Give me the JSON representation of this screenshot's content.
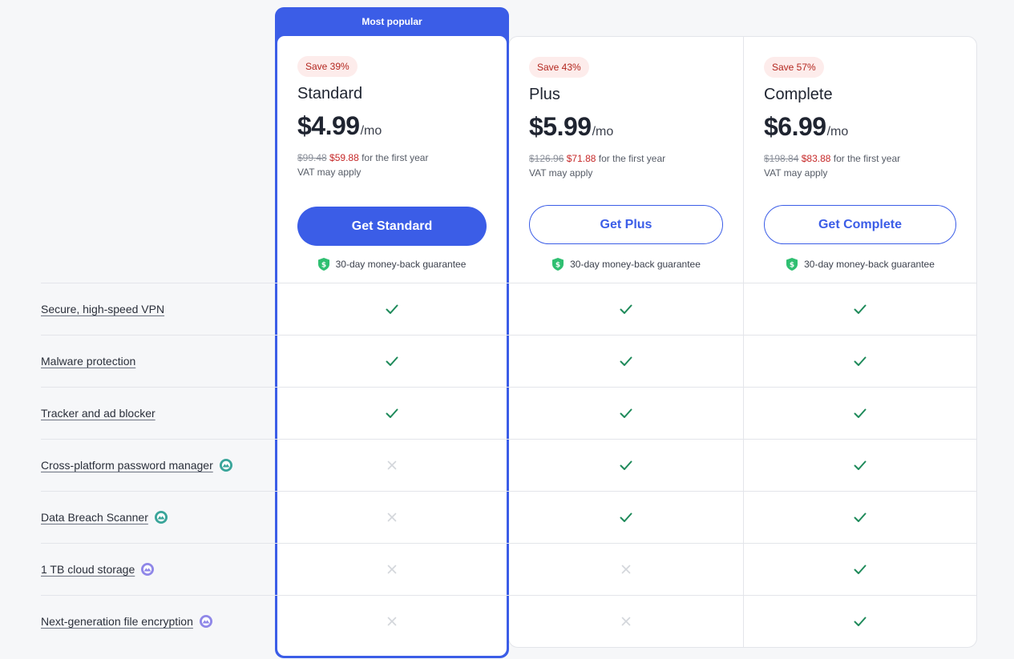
{
  "banner": {
    "label": "Most popular"
  },
  "plans": [
    {
      "save": "Save 39%",
      "name": "Standard",
      "price": "$4.99",
      "per": "/mo",
      "old_price": "$99.48",
      "new_price": "$59.88",
      "first_year": "for the first year",
      "vat": "VAT may apply",
      "cta": "Get Standard",
      "guarantee": "30-day money-back guarantee"
    },
    {
      "save": "Save 43%",
      "name": "Plus",
      "price": "$5.99",
      "per": "/mo",
      "old_price": "$126.96",
      "new_price": "$71.88",
      "first_year": "for the first year",
      "vat": "VAT may apply",
      "cta": "Get Plus",
      "guarantee": "30-day money-back guarantee"
    },
    {
      "save": "Save 57%",
      "name": "Complete",
      "price": "$6.99",
      "per": "/mo",
      "old_price": "$198.84",
      "new_price": "$83.88",
      "first_year": "for the first year",
      "vat": "VAT may apply",
      "cta": "Get Complete",
      "guarantee": "30-day money-back guarantee"
    }
  ],
  "features": [
    {
      "label": "Secure, high-speed VPN",
      "addon": "",
      "included": [
        true,
        true,
        true
      ]
    },
    {
      "label": "Malware protection",
      "addon": "",
      "included": [
        true,
        true,
        true
      ]
    },
    {
      "label": "Tracker and ad blocker",
      "addon": "",
      "included": [
        true,
        true,
        true
      ]
    },
    {
      "label": "Cross-platform password manager",
      "addon": "password-manager-icon",
      "included": [
        false,
        true,
        true
      ]
    },
    {
      "label": "Data Breach Scanner",
      "addon": "password-manager-icon",
      "included": [
        false,
        true,
        true
      ]
    },
    {
      "label": "1 TB cloud storage",
      "addon": "cloud-storage-icon",
      "included": [
        false,
        false,
        true
      ]
    },
    {
      "label": "Next-generation file encryption",
      "addon": "cloud-storage-icon",
      "included": [
        false,
        false,
        true
      ]
    }
  ],
  "colors": {
    "accent": "#3b5de7",
    "check": "#1e8a5a",
    "cross": "#d3d6db",
    "save_badge_bg": "#fdeceb",
    "save_badge_text": "#b3261e",
    "discount_price": "#c62828",
    "shield": "#2fbf71",
    "addon_teal": "#3aa59a",
    "addon_purple": "#8f87e8"
  }
}
